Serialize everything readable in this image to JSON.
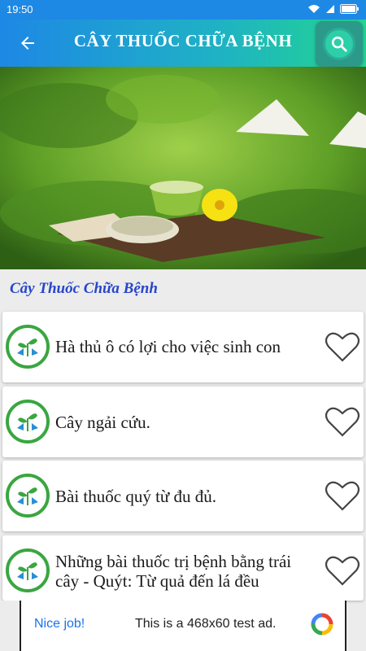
{
  "status_bar": {
    "time": "19:50"
  },
  "toolbar": {
    "title": "CÂY THUỐC CHỮA BỆNH"
  },
  "section": {
    "title": "Cây Thuốc Chữa Bệnh"
  },
  "items": [
    {
      "title": "Hà thủ ô có lợi cho việc sinh con"
    },
    {
      "title": "Cây ngải cứu."
    },
    {
      "title": "Bài thuốc quý từ đu đủ."
    },
    {
      "title": "Những bài thuốc trị bệnh bằng trái cây - Quýt: Từ quả đến lá đều"
    }
  ],
  "ad": {
    "label": "Nice job!",
    "text": "This is a 468x60 test ad."
  },
  "icons": {
    "back": "arrow-left-icon",
    "search": "search-icon",
    "favorite": "heart-outline-icon",
    "logo": "plant-logo-icon",
    "wifi": "wifi-icon",
    "signal": "signal-icon",
    "battery": "battery-icon"
  },
  "colors": {
    "toolbar_start": "#1e88e5",
    "toolbar_end": "#22d690",
    "section_title": "#2746c9",
    "logo_green": "#3aa640"
  }
}
